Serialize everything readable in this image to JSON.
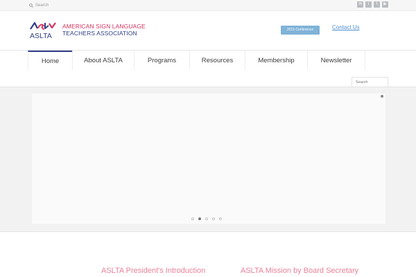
{
  "topbar": {
    "search_placeholder": "Search",
    "social_icons": [
      "mail-icon",
      "twitter-icon",
      "facebook-icon",
      "youtube-icon"
    ],
    "social_glyphs": [
      "✉",
      "t",
      "f",
      "▶"
    ]
  },
  "logo": {
    "mark": "ASLTA",
    "line1": "AMERICAN SIGN LANGUAGE",
    "line2": "TEACHERS ASSOCIATION"
  },
  "header": {
    "conference_label": "2015 Conference",
    "contact_label": "Contact Us"
  },
  "nav": {
    "items": [
      {
        "label": "Home",
        "active": true
      },
      {
        "label": "About ASLTA",
        "active": false
      },
      {
        "label": "Programs",
        "active": false
      },
      {
        "label": "Resources",
        "active": false
      },
      {
        "label": "Membership",
        "active": false
      },
      {
        "label": "Newsletter",
        "active": false
      }
    ],
    "search_placeholder": "Search"
  },
  "slider": {
    "slide_count": 5,
    "active_index": 1
  },
  "sections": {
    "left_heading": "ASLTA President's Introduction",
    "right_heading": "ASLTA Mission by Board Secretary"
  },
  "colors": {
    "brand_red": "#d2325e",
    "brand_blue": "#2f3e86",
    "button_blue": "#7fb3d8",
    "link_blue": "#4d8fd0",
    "heading_pink": "#e8829a"
  }
}
